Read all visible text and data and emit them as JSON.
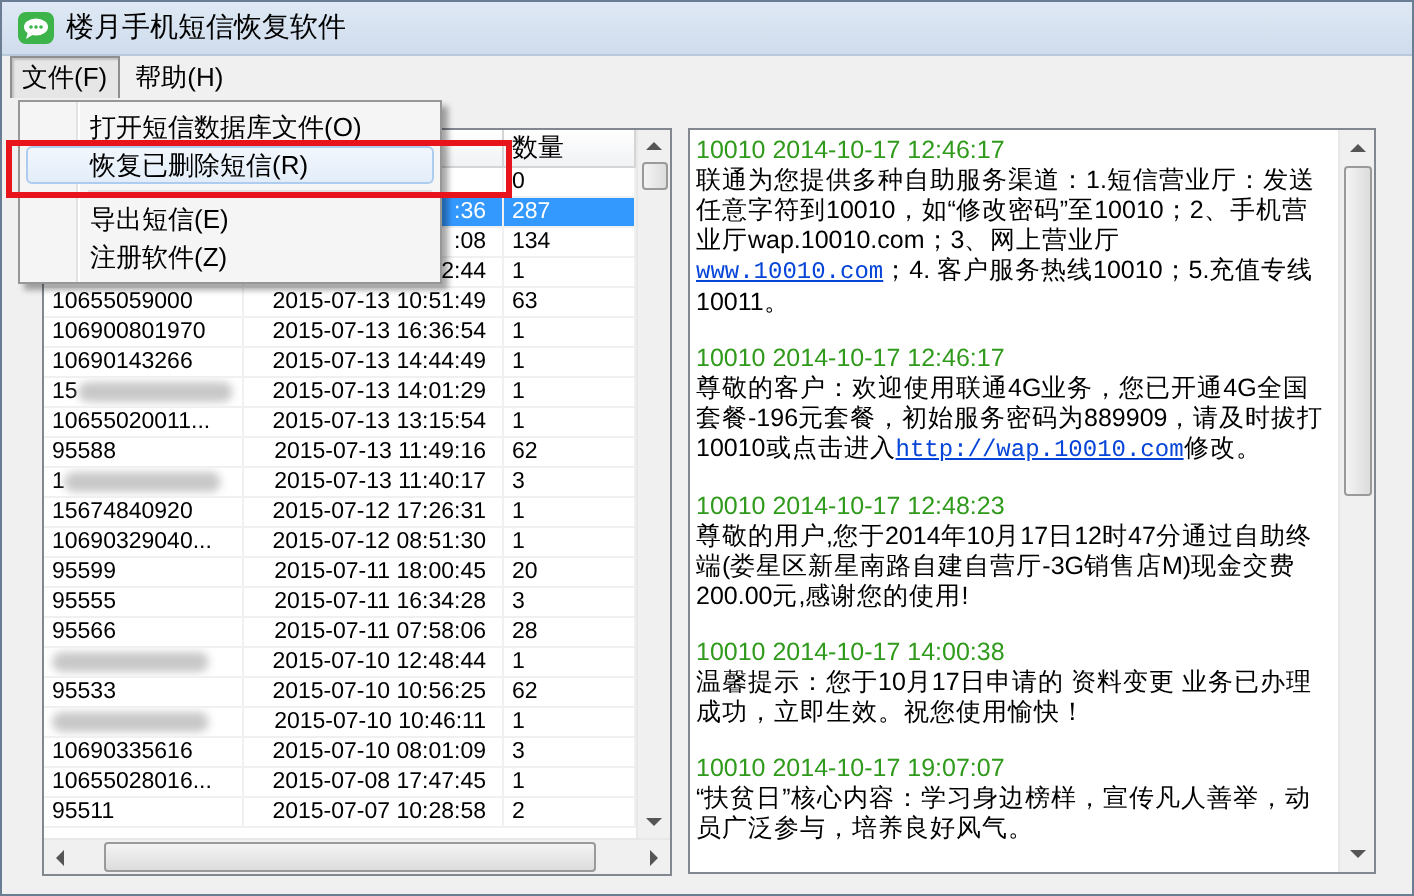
{
  "window": {
    "title": "楼月手机短信恢复软件"
  },
  "menu_bar": [
    {
      "label": "文件(F)",
      "selected": true
    },
    {
      "label": "帮助(H)",
      "selected": false
    }
  ],
  "file_menu": {
    "items": [
      {
        "kind": "item",
        "label": "打开短信数据库文件(O)",
        "highlighted": false
      },
      {
        "kind": "item",
        "label": "恢复已删除短信(R)",
        "highlighted": true
      },
      {
        "kind": "separator"
      },
      {
        "kind": "item",
        "label": "导出短信(E)",
        "highlighted": false
      },
      {
        "kind": "item",
        "label": "注册软件(Z)",
        "highlighted": false
      }
    ]
  },
  "table": {
    "column_3": "数量",
    "rows": [
      {
        "count": "0",
        "selected": false,
        "blurred": false
      },
      {
        "time": ":36",
        "count": "287",
        "selected": true,
        "blurred": false
      },
      {
        "time": ":08",
        "count": "134",
        "selected": false,
        "blurred": false
      },
      {
        "time": "2:44",
        "count": "1",
        "selected": false,
        "blurred": false
      },
      {
        "number": "10655059000",
        "time": "2015-07-13 10:51:49",
        "count": "63",
        "selected": false,
        "blurred": false
      },
      {
        "number": "106900801970",
        "time": "2015-07-13 16:36:54",
        "count": "1",
        "selected": false,
        "blurred": false
      },
      {
        "number": "10690143266",
        "time": "2015-07-13 14:44:49",
        "count": "1",
        "selected": false,
        "blurred": false
      },
      {
        "number": "15",
        "time": "2015-07-13 14:01:29",
        "count": "1",
        "selected": false,
        "blurred": true
      },
      {
        "number": "10655020011...",
        "time": "2015-07-13 13:15:54",
        "count": "1",
        "selected": false,
        "blurred": false
      },
      {
        "number": "95588",
        "time": "2015-07-13 11:49:16",
        "count": "62",
        "selected": false,
        "blurred": false
      },
      {
        "number": "1",
        "time": "2015-07-13 11:40:17",
        "count": "3",
        "selected": false,
        "blurred": true
      },
      {
        "number": "15674840920",
        "time": "2015-07-12 17:26:31",
        "count": "1",
        "selected": false,
        "blurred": false
      },
      {
        "number": "10690329040...",
        "time": "2015-07-12 08:51:30",
        "count": "1",
        "selected": false,
        "blurred": false
      },
      {
        "number": "95599",
        "time": "2015-07-11 18:00:45",
        "count": "20",
        "selected": false,
        "blurred": false
      },
      {
        "number": "95555",
        "time": "2015-07-11 16:34:28",
        "count": "3",
        "selected": false,
        "blurred": false
      },
      {
        "number": "95566",
        "time": "2015-07-11 07:58:06",
        "count": "28",
        "selected": false,
        "blurred": false
      },
      {
        "time": "2015-07-10 12:48:44",
        "count": "1",
        "selected": false,
        "blurred": true
      },
      {
        "number": "95533",
        "time": "2015-07-10 10:56:25",
        "count": "62",
        "selected": false,
        "blurred": false
      },
      {
        "time": "2015-07-10 10:46:11",
        "count": "1",
        "selected": false,
        "blurred": true
      },
      {
        "number": "10690335616",
        "time": "2015-07-10 08:01:09",
        "count": "3",
        "selected": false,
        "blurred": false
      },
      {
        "number": "10655028016...",
        "time": "2015-07-08 17:47:45",
        "count": "1",
        "selected": false,
        "blurred": false
      },
      {
        "number": "95511",
        "time": "2015-07-07 10:28:58",
        "count": "2",
        "selected": false,
        "blurred": false
      }
    ]
  },
  "messages": [
    {
      "header": "10010 2014-10-17 12:46:17",
      "body": [
        {
          "kind": "text",
          "text": "联通为您提供多种自助服务渠道：1.短信营业厅：发送任意字符到10010，如“修改密码”至10010；2、手机营业厅wap.10010.com；3、网上营业厅"
        },
        {
          "kind": "link",
          "text": "www.10010.com"
        },
        {
          "kind": "text",
          "text": "；4. 客户服务热线10010；5.充值专线10011。"
        }
      ]
    },
    {
      "header": "10010 2014-10-17 12:46:17",
      "body": [
        {
          "kind": "text",
          "text": "尊敬的客户：欢迎使用联通4G业务，您已开通4G全国套餐-196元套餐，初始服务密码为889909，请及时拔打10010或点击进入"
        },
        {
          "kind": "link",
          "text": "http://wap.10010.com"
        },
        {
          "kind": "text",
          "text": "修改。"
        }
      ]
    },
    {
      "header": "10010 2014-10-17 12:48:23",
      "body": [
        {
          "kind": "text",
          "text": "尊敬的用户,您于2014年10月17日12时47分通过自助终端(娄星区新星南路自建自营厅-3G销售店M)现金交费200.00元,感谢您的使用!"
        }
      ]
    },
    {
      "header": "10010 2014-10-17 14:00:38",
      "body": [
        {
          "kind": "text",
          "text": "温馨提示：您于10月17日申请的 资料变更 业务已办理成功，立即生效。祝您使用愉快！"
        }
      ]
    },
    {
      "header": "10010 2014-10-17 19:07:07",
      "body": [
        {
          "kind": "text",
          "text": "“扶贫日”核心内容：学习身边榜样，宣传凡人善举，动员广泛参与，培养良好风气。"
        }
      ]
    }
  ]
}
